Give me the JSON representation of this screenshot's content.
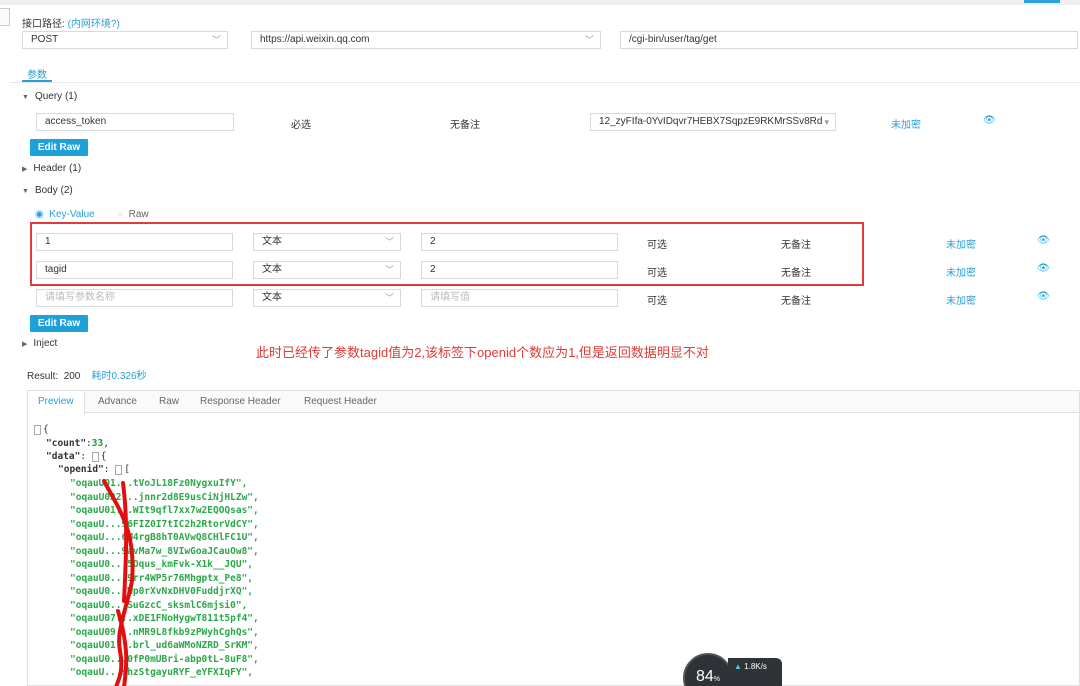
{
  "header": {
    "path_label": "接口路径:",
    "path_link": "(内网环境?)",
    "method": "POST",
    "host": "https://api.weixin.qq.com",
    "path": "/cgi-bin/user/tag/get"
  },
  "tabs": {
    "params": "参数"
  },
  "query": {
    "title": "Query (1)",
    "row": {
      "name": "access_token",
      "required": "必选",
      "note": "无备注",
      "value": "12_zyFIfa-0YvIDqvr7HEBX7SqpzE9RKMrSSv8Rd",
      "encrypt": "未加密"
    },
    "edit_raw": "Edit Raw"
  },
  "header_section": {
    "title": "Header (1)"
  },
  "body": {
    "title": "Body (2)",
    "mode_kv": "Key-Value",
    "mode_raw": "Raw",
    "rows": [
      {
        "name": "1",
        "type": "文本",
        "value": "2",
        "required": "可选",
        "note": "无备注",
        "encrypt": "未加密"
      },
      {
        "name": "tagid",
        "type": "文本",
        "value": "2",
        "required": "可选",
        "note": "无备注",
        "encrypt": "未加密"
      }
    ],
    "new_row": {
      "name_placeholder": "请填写参数名称",
      "type": "文本",
      "value_placeholder": "请填写值",
      "required": "可选",
      "note": "无备注",
      "encrypt": "未加密"
    },
    "edit_raw": "Edit Raw"
  },
  "inject": {
    "title": "Inject"
  },
  "annotation": "此时已经传了参数tagid值为2,该标签下openid个数应为1,但是返回数据明显不对",
  "result": {
    "label": "Result:",
    "code": "200",
    "time": "耗时0.326秒"
  },
  "response_tabs": [
    "Preview",
    "Advance",
    "Raw",
    "Response Header",
    "Request Header"
  ],
  "response": {
    "count_key": "\"count\"",
    "count_value": "33",
    "data_key": "\"data\"",
    "openid_key": "\"openid\"",
    "openids": [
      "\"oqauU01...tVoJL18Fz0NygxuIfY\",",
      "\"oqauU022...jnnr2d8E9usCiNjHLZw\",",
      "\"oqauU01...WIt9qfl7xx7w2EQOQsas\",",
      "\"oqauU...96FIZ0I7tIC2h2RtorVdCY\",",
      "\"oqauU...6M4rgB8hT0AVwQ8CHlFC1U\",",
      "\"oqauU...9avMa7w_8VIwGoaJCauOw8\",",
      "\"oqauU0...5Oqus_kmFvk-X1k__JQU\",",
      "\"oqauU0...9rr4WP5r76Mhgptx_Pe8\",",
      "\"oqauU0...Wp0rXvNxDHV0FuddjrXQ\",",
      "\"oqauU0...SuGzcC_sksmlC6mjsi0\",",
      "\"oqauU07...xDE1FNoHygwT811t5pf4\",",
      "\"oqauU09...nMR9L8fkb9zPWyhCghQs\",",
      "\"oqauU01...brl_ud6aWMoNZRD_SrKM\",",
      "\"oqauU0...0fP0mUBri-abp0tL-8uF8\",",
      "\"oqauU...shzStgayuRYF_eYFXIqFY\","
    ]
  },
  "monitor": {
    "percent": "84",
    "percent_unit": "%",
    "speed": "1.8K/s"
  }
}
